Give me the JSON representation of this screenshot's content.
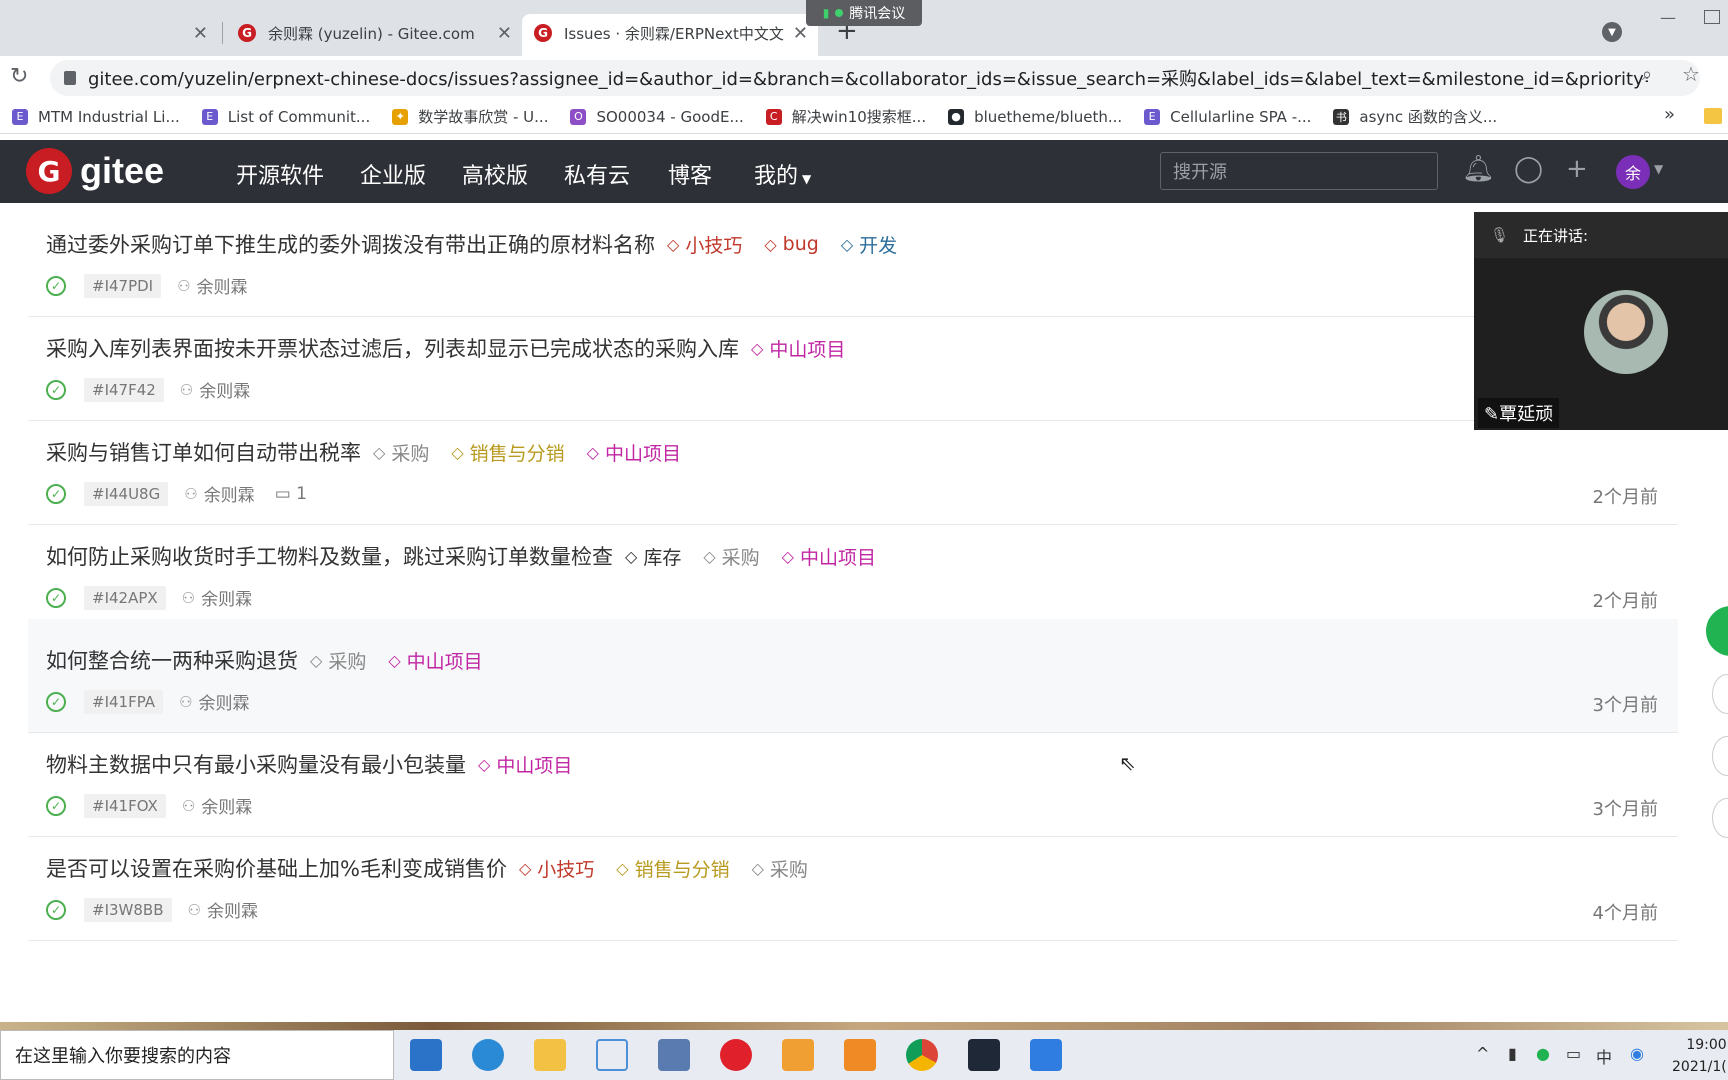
{
  "browser": {
    "tabs": [
      {
        "label": "",
        "active": false
      },
      {
        "label": "余则霖 (yuzelin) - Gitee.com",
        "active": false
      },
      {
        "label": "Issues · 余则霖/ERPNext中文文",
        "active": true
      }
    ],
    "meeting_badge": "腾讯会议",
    "url": "gitee.com/yuzelin/erpnext-chinese-docs/issues?assignee_id=&author_id=&branch=&collaborator_ids=&issue_search=采购&label_ids=&label_text=&milestone_id=&priority=&priva...",
    "bookmarks": [
      {
        "label": "MTM Industrial Li...",
        "icon": "E",
        "color": "#6a5acd"
      },
      {
        "label": "List of Communit...",
        "icon": "E",
        "color": "#6a5acd"
      },
      {
        "label": "数学故事欣赏 - U...",
        "icon": "✦",
        "color": "#e6a100"
      },
      {
        "label": "SO00034 - GoodE...",
        "icon": "O",
        "color": "#8e4ec6"
      },
      {
        "label": "解决win10搜索框...",
        "icon": "C",
        "color": "#c71d23"
      },
      {
        "label": "bluetheme/blueth...",
        "icon": "●",
        "color": "#24292e"
      },
      {
        "label": "Cellularline SPA -...",
        "icon": "E",
        "color": "#6a5acd"
      },
      {
        "label": "async 函数的含义...",
        "icon": "书",
        "color": "#333333"
      }
    ],
    "bookmarks_more": "»"
  },
  "nav": {
    "logo_text": "gitee",
    "logo_letter": "G",
    "items": [
      "开源软件",
      "企业版",
      "高校版",
      "私有云",
      "博客",
      "我的"
    ],
    "search_placeholder": "搜开源",
    "avatar": "余"
  },
  "issues": [
    {
      "title": "通过委外采购订单下推生成的委外调拨没有带出正确的原材料名称",
      "labels": [
        {
          "text": "小技巧",
          "color": "#c0392b"
        },
        {
          "text": "bug",
          "color": "#c0392b"
        },
        {
          "text": "开发",
          "color": "#2c6e9b"
        }
      ],
      "number": "#I47PDI",
      "author": "余则霖",
      "comments": "",
      "time": ""
    },
    {
      "title": "采购入库列表界面按未开票状态过滤后，列表却显示已完成状态的采购入库",
      "labels": [
        {
          "text": "中山项目",
          "color": "#c026a3"
        }
      ],
      "number": "#I47F42",
      "author": "余则霖",
      "comments": "",
      "time": ""
    },
    {
      "title": "采购与销售订单如何自动带出税率",
      "labels": [
        {
          "text": "采购",
          "color": "#888888"
        },
        {
          "text": "销售与分销",
          "color": "#b89a1e"
        },
        {
          "text": "中山项目",
          "color": "#c026a3"
        }
      ],
      "number": "#I44U8G",
      "author": "余则霖",
      "comments": "1",
      "time": "2个月前"
    },
    {
      "title": "如何防止采购收货时手工物料及数量，跳过采购订单数量检查",
      "labels": [
        {
          "text": "库存",
          "color": "#333333"
        },
        {
          "text": "采购",
          "color": "#888888"
        },
        {
          "text": "中山项目",
          "color": "#c026a3"
        }
      ],
      "number": "#I42APX",
      "author": "余则霖",
      "comments": "",
      "time": "2个月前"
    },
    {
      "title": "如何整合统一两种采购退货",
      "labels": [
        {
          "text": "采购",
          "color": "#888888"
        },
        {
          "text": "中山项目",
          "color": "#c026a3"
        }
      ],
      "number": "#I41FPA",
      "author": "余则霖",
      "comments": "",
      "time": "3个月前"
    },
    {
      "title": "物料主数据中只有最小采购量没有最小包装量",
      "labels": [
        {
          "text": "中山项目",
          "color": "#c026a3"
        }
      ],
      "number": "#I41FOX",
      "author": "余则霖",
      "comments": "",
      "time": "3个月前"
    },
    {
      "title": "是否可以设置在采购价基础上加%毛利变成销售价",
      "labels": [
        {
          "text": "小技巧",
          "color": "#c0392b"
        },
        {
          "text": "销售与分销",
          "color": "#b89a1e"
        },
        {
          "text": "采购",
          "color": "#888888"
        }
      ],
      "number": "#I3W8BB",
      "author": "余则霖",
      "comments": "",
      "time": "4个月前"
    }
  ],
  "video": {
    "header": "正在讲话:",
    "speaker": "覃延顽"
  },
  "taskbar": {
    "search_placeholder": "在这里输入你要搜索的内容",
    "ime": "中",
    "clock_time": "19:00",
    "clock_date": "2021/1("
  }
}
